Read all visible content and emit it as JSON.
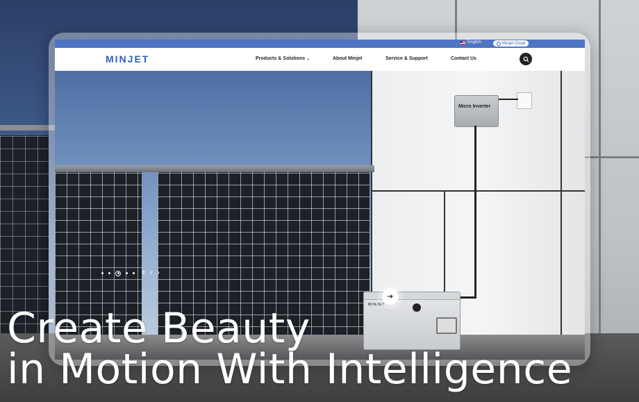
{
  "topbar": {
    "language": "English",
    "cloud": "Minjet Cloud"
  },
  "nav": {
    "logo": "MINJET",
    "items": [
      "Products & Solutions",
      "About Minjet",
      "Service & Support",
      "Contact Us"
    ]
  },
  "hero": {
    "inverter_label": "Micro Inverter",
    "battery_logo": "MINJET",
    "slider": {
      "slide_count": 5,
      "active_index": 2
    },
    "headline_line1": "Create Beauty",
    "headline_line2": "in Motion With Intelligence"
  },
  "icons": {
    "flag": "us-flag-icon",
    "cloud": "cloud-icon",
    "search": "search-icon",
    "dropdown": "chevron-down-icon",
    "pause": "pause-icon",
    "prev": "chevron-left-icon",
    "next_slide": "chevron-right-icon",
    "next": "arrow-right-icon"
  },
  "colors": {
    "brand": "#2f5fb3",
    "topbar": "#4e74c4"
  }
}
